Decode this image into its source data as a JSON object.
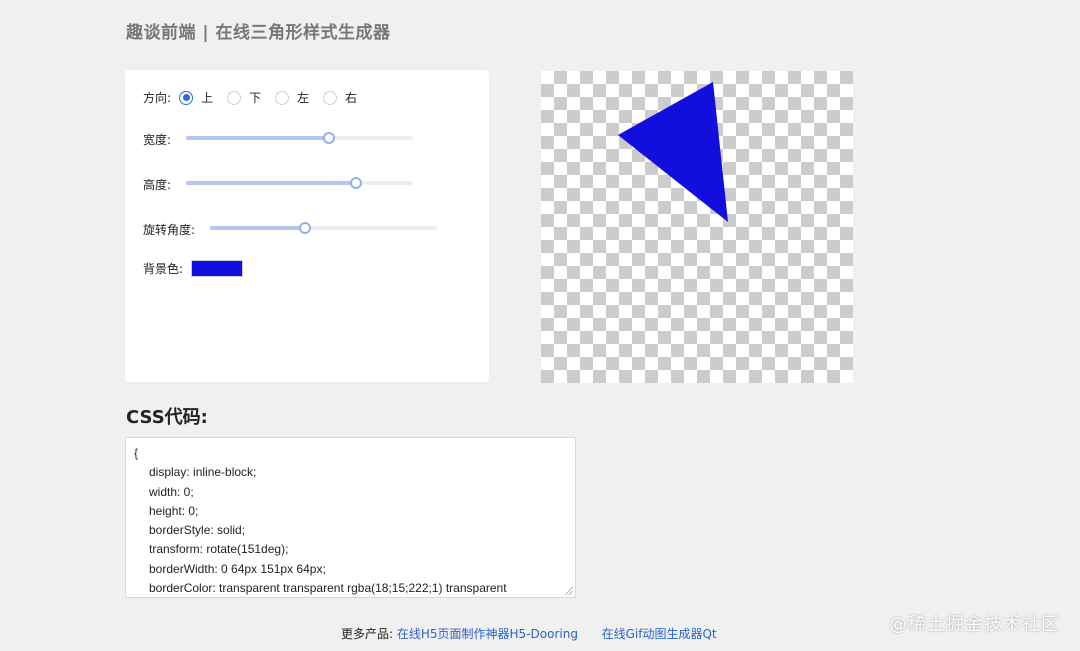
{
  "header": {
    "title": "趣谈前端 | 在线三角形样式生成器"
  },
  "controls": {
    "direction": {
      "label": "方向:",
      "options": [
        "上",
        "下",
        "左",
        "右"
      ],
      "selected": "上"
    },
    "width": {
      "label": "宽度:",
      "value_fraction": 0.63
    },
    "height": {
      "label": "高度:",
      "value_fraction": 0.75
    },
    "rotation": {
      "label": "旋转角度:",
      "value_fraction": 0.42
    },
    "background": {
      "label": "背景色:",
      "color": "#120fde"
    }
  },
  "css_section": {
    "heading": "CSS代码:",
    "lines": [
      "{",
      "display: inline-block;",
      "width: 0;",
      "height: 0;",
      "borderStyle: solid;",
      "transform: rotate(151deg);",
      "borderWidth: 0 64px 151px 64px;",
      "borderColor: transparent transparent rgba(18;15;222;1) transparent"
    ]
  },
  "footer": {
    "prefix": "更多产品:",
    "link1": "在线H5页面制作神器H5-Dooring",
    "link2": "在线Gif动图生成器Qt"
  },
  "watermark": "@稀土掘金技术社区",
  "colors": {
    "accent": "#2f6bdb",
    "triangle": "#120fde",
    "link": "#2a62c9"
  }
}
